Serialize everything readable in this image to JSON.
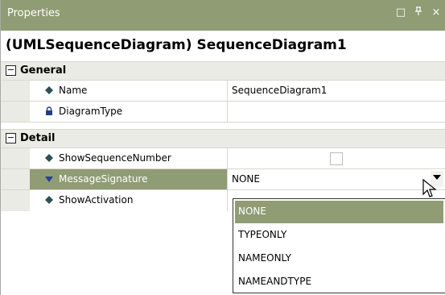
{
  "titlebar": {
    "title": "Properties",
    "icons": [
      {
        "name": "maximize-icon",
        "glyph": "□"
      },
      {
        "name": "pin-icon",
        "glyph": "ᵖ"
      },
      {
        "name": "close-icon",
        "glyph": "×"
      }
    ]
  },
  "object_name": "(UMLSequenceDiagram) SequenceDiagram1",
  "categories": {
    "general": {
      "label": "General",
      "toggle": "⊟"
    },
    "detail": {
      "label": "Detail",
      "toggle": "⊟"
    }
  },
  "rows": {
    "name": {
      "label": "Name",
      "value": "SequenceDiagram1",
      "icon": "diamond-icon"
    },
    "diagram_type": {
      "label": "DiagramType",
      "value": "",
      "icon": "lock-icon"
    },
    "show_sequence_number": {
      "label": "ShowSequenceNumber",
      "checked": false,
      "icon": "diamond-icon"
    },
    "message_signature": {
      "label": "MessageSignature",
      "value": "NONE",
      "icon": "triangle-down-icon"
    },
    "show_activation": {
      "label": "ShowActivation",
      "icon": "diamond-icon"
    }
  },
  "dropdown": {
    "options": [
      "NONE",
      "TYPEONLY",
      "NAMEONLY",
      "NAMEANDTYPE"
    ],
    "selected": "NONE"
  },
  "colors": {
    "accent": "#8f9c74",
    "category_bg": "#ebebe5"
  }
}
